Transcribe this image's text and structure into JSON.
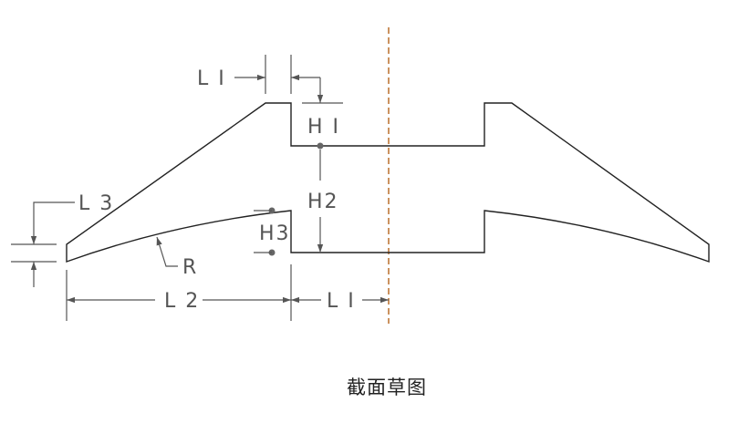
{
  "diagram": {
    "caption": "截面草图",
    "labels": {
      "l1_top": "L I",
      "h1": "H I",
      "h2": "H2",
      "h3": "H3",
      "l3": "L 3",
      "r": "R",
      "l2": "L 2",
      "l1_bottom": "L I"
    },
    "colors": {
      "profile": "#222222",
      "dimension": "#555555",
      "centerline": "#b5651d",
      "point": "#666666"
    }
  }
}
